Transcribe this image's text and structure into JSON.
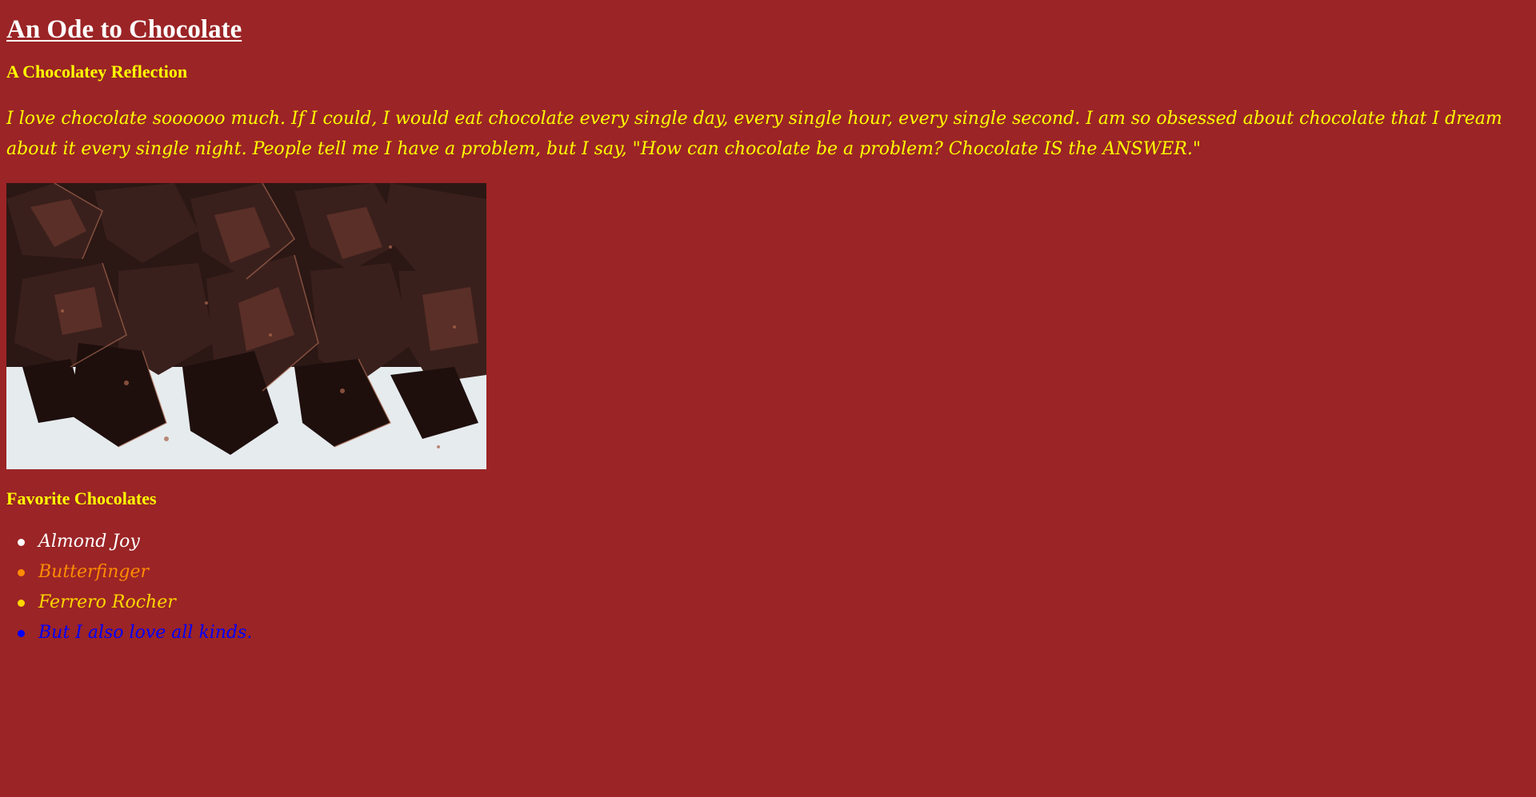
{
  "page": {
    "title": "An Ode to Chocolate",
    "subtitle": "A Chocolatey Reflection",
    "intro": "I love chocolate soooooo much. If I could, I would eat chocolate every single day, every single hour, every single second. I am so obsessed about chocolate that I dream about it every single night. People tell me I have a problem, but I say, \"How can chocolate be a problem? Chocolate IS the ANSWER.\"",
    "image_icon": "chocolate-photo",
    "favorites_heading": "Favorite Chocolates",
    "favorites": [
      {
        "label": "Almond Joy",
        "color": "#ffffff"
      },
      {
        "label": "Butterfinger",
        "color": "#ff8c00"
      },
      {
        "label": "Ferrero Rocher",
        "color": "#ffd700"
      },
      {
        "label": "But I also love all kinds.",
        "color": "#0000ff"
      }
    ]
  },
  "colors": {
    "background": "#9b2426",
    "heading": "#ffffff",
    "accent": "#ffff00"
  }
}
